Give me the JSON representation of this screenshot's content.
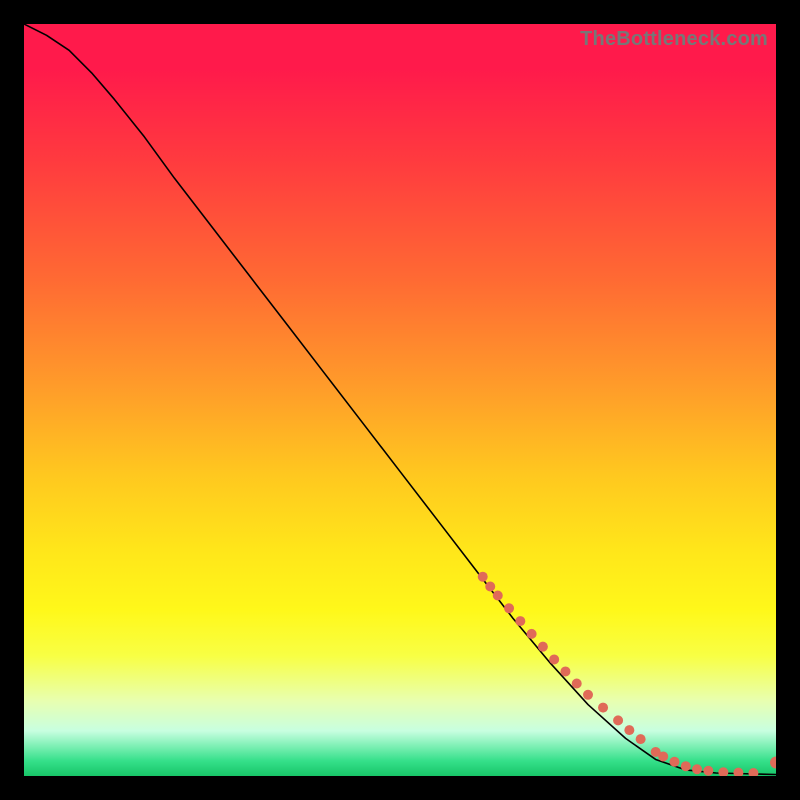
{
  "watermark": "TheBottleneck.com",
  "colors": {
    "curve": "#000000",
    "dot": "#e06a58",
    "background_top": "#ff1a4b",
    "background_mid": "#ffe61a",
    "background_bottom": "#18c568"
  },
  "chart_data": {
    "type": "line",
    "title": "",
    "xlabel": "",
    "ylabel": "",
    "xlim": [
      0,
      100
    ],
    "ylim": [
      0,
      100
    ],
    "grid": false,
    "legend": false,
    "series": [
      {
        "name": "curve",
        "x": [
          0,
          3,
          6,
          9,
          12,
          16,
          20,
          25,
          30,
          35,
          40,
          45,
          50,
          55,
          60,
          65,
          70,
          75,
          80,
          84,
          88,
          92,
          96,
          100
        ],
        "y": [
          100,
          98.5,
          96.5,
          93.5,
          90,
          85,
          79.5,
          73,
          66.5,
          60,
          53.5,
          47,
          40.5,
          34,
          27.5,
          21,
          15,
          9.5,
          5,
          2.2,
          0.8,
          0.4,
          0.3,
          0.2
        ]
      }
    ],
    "points": {
      "name": "highlight-dots",
      "x": [
        61,
        62,
        63,
        64.5,
        66,
        67.5,
        69,
        70.5,
        72,
        73.5,
        75,
        77,
        79,
        80.5,
        82,
        84,
        85,
        86.5,
        88,
        89.5,
        91,
        93,
        95,
        97,
        100
      ],
      "y": [
        26.5,
        25.2,
        24,
        22.3,
        20.6,
        18.9,
        17.2,
        15.5,
        13.9,
        12.3,
        10.8,
        9.1,
        7.4,
        6.1,
        4.9,
        3.2,
        2.6,
        1.9,
        1.3,
        0.9,
        0.7,
        0.5,
        0.45,
        0.4,
        1.8
      ],
      "r": [
        5,
        5,
        5,
        5,
        5,
        5,
        5,
        5,
        5,
        5,
        5,
        5,
        5,
        5,
        5,
        5,
        5,
        5,
        5,
        5,
        5,
        5,
        5,
        5,
        6
      ]
    }
  }
}
